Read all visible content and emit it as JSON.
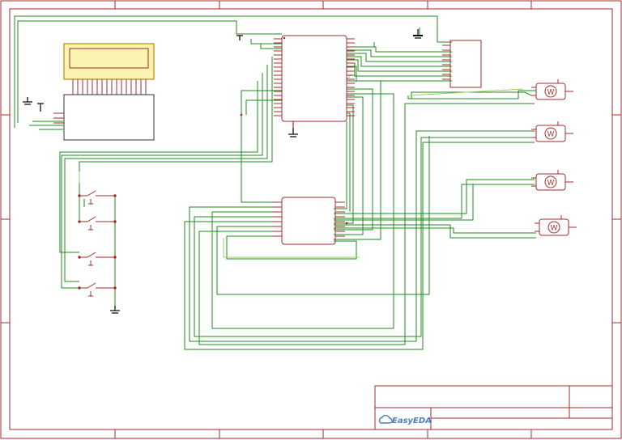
{
  "app": {
    "logo_text": "EasyEDA"
  },
  "colors": {
    "frame": "#a52a2a",
    "wire": "#1a8c1a",
    "wire_light": "#9acd6a",
    "lcd_fill": "#fbf3b0",
    "lcd_border": "#b58a00",
    "ground": "#000000",
    "logo": "#4a7fc0"
  },
  "components": {
    "lcd": {
      "pin_count": 16
    },
    "mcu": {
      "pins_per_side": 20
    },
    "driver": {
      "pins_per_side": 8
    },
    "header": {
      "pin_count": 8
    },
    "switches": {
      "count": 4
    },
    "motors": {
      "count": 4,
      "symbol": "W"
    }
  }
}
